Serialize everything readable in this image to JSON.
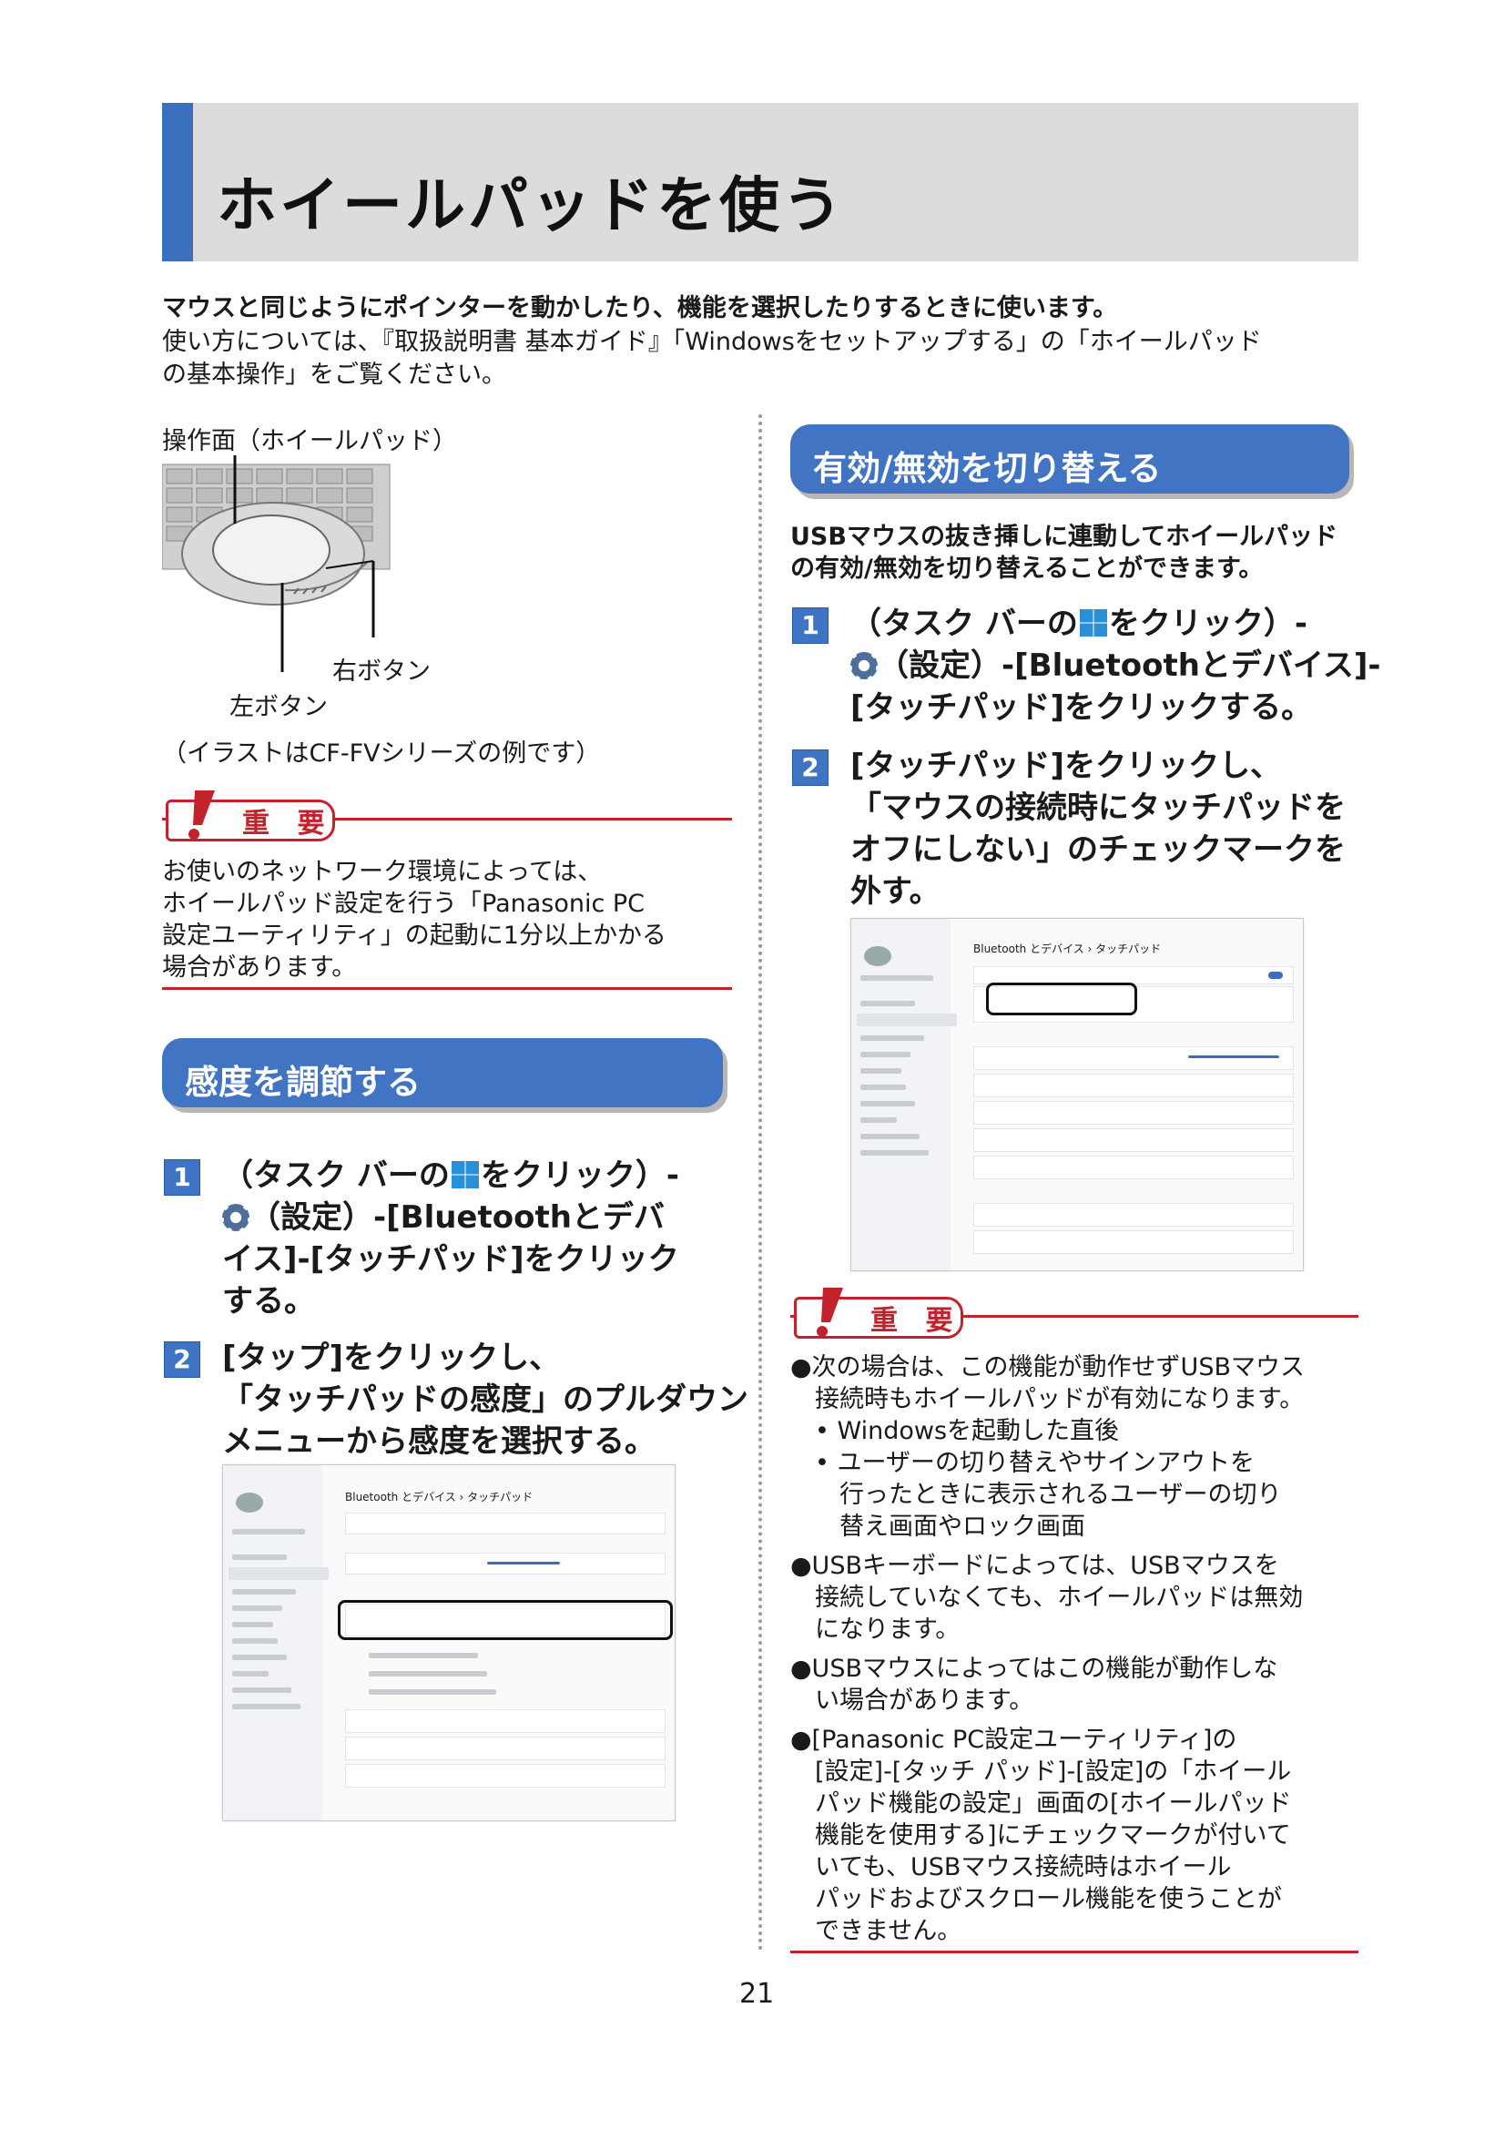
{
  "title": "ホイールパッドを使う",
  "intro": {
    "lead": "マウスと同じようにポインターを動かしたり、機能を選択したりするときに使います。",
    "line1": "使い方については、『取扱説明書 基本ガイド』「Windowsをセットアップする」の「ホイールパッド",
    "line2": "の基本操作」をご覧ください。"
  },
  "illustration": {
    "label": "操作面（ホイールパッド）",
    "right_button": "右ボタン",
    "left_button": "左ボタン",
    "caption": "（イラストはCF-FVシリーズの例です）"
  },
  "important_label": "重 要",
  "important_left": {
    "lines": [
      "お使いのネットワーク環境によっては、",
      "ホイールパッド設定を行う「Panasonic PC",
      "設定ユーティリティ」の起動に1分以上かかる",
      "場合があります。"
    ]
  },
  "section_sensitivity": {
    "title": "感度を調節する",
    "step1": {
      "num": "1",
      "l1a": "（タスク バーの",
      "l1b": "をクリック）-",
      "l2": "（設定）-[Bluetoothとデバ",
      "l3": "イス]-[タッチパッド]をクリック",
      "l4": "する。"
    },
    "step2": {
      "num": "2",
      "l1": "[タップ]をクリックし、",
      "l2": "「タッチパッドの感度」のプルダウン",
      "l3": "メニューから感度を選択する。"
    }
  },
  "section_toggle": {
    "title": "有効/無効を切り替える",
    "desc1": "USBマウスの抜き挿しに連動してホイールパッド",
    "desc2": "の有効/無効を切り替えることができます。",
    "step1": {
      "num": "1",
      "l1a": "（タスク バーの",
      "l1b": "をクリック）-",
      "l2": "（設定）-[Bluetoothとデバイス]-",
      "l3": "[タッチパッド]をクリックする。"
    },
    "step2": {
      "num": "2",
      "l1": "[タッチパッド]をクリックし、",
      "l2": "「マウスの接続時にタッチパッドを",
      "l3": "オフにしない」のチェックマークを",
      "l4": "外す。"
    }
  },
  "important_right": {
    "b1": [
      "●次の場合は、この機能が動作せずUSBマウス",
      "　接続時もホイールパッドが有効になります。",
      "　• Windowsを起動した直後",
      "　• ユーザーの切り替えやサインアウトを",
      "　　行ったときに表示されるユーザーの切り",
      "　　替え画面やロック画面"
    ],
    "b2": [
      "●USBキーボードによっては、USBマウスを",
      "　接続していなくても、ホイールパッドは無効",
      "　になります。"
    ],
    "b3": [
      "●USBマウスによってはこの機能が動作しな",
      "　い場合があります。"
    ],
    "b4": [
      "●[Panasonic PC設定ユーティリティ]の",
      "　[設定]-[タッチ パッド]-[設定]の「ホイール",
      "　パッド機能の設定」画面の[ホイールパッド",
      "　機能を使用する]にチェックマークが付いて",
      "　いても、USBマウス接続時はホイール",
      "　パッドおよびスクロール機能を使うことが",
      "　できません。"
    ]
  },
  "screenshot": {
    "breadcrumb": "Bluetooth とデバイス › タッチパッド"
  },
  "page_number": "21"
}
